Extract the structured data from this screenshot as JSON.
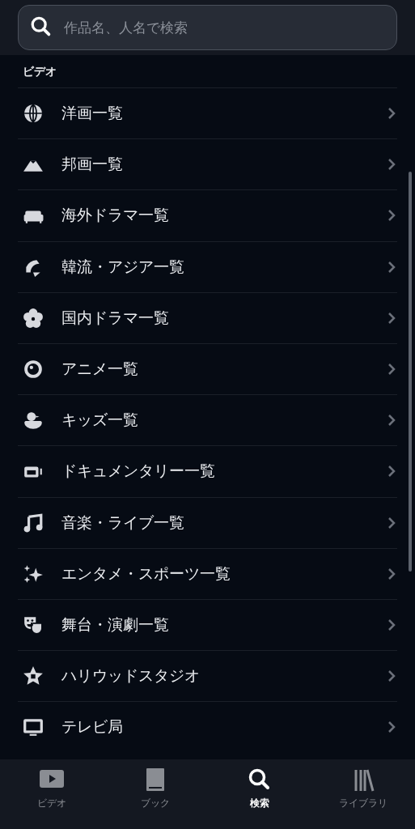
{
  "search": {
    "placeholder": "作品名、人名で検索"
  },
  "section": {
    "title": "ビデオ"
  },
  "items": [
    {
      "label": "洋画一覧"
    },
    {
      "label": "邦画一覧"
    },
    {
      "label": "海外ドラマ一覧"
    },
    {
      "label": "韓流・アジア一覧"
    },
    {
      "label": "国内ドラマ一覧"
    },
    {
      "label": "アニメ一覧"
    },
    {
      "label": "キッズ一覧"
    },
    {
      "label": "ドキュメンタリー一覧"
    },
    {
      "label": "音楽・ライブ一覧"
    },
    {
      "label": "エンタメ・スポーツ一覧"
    },
    {
      "label": "舞台・演劇一覧"
    },
    {
      "label": "ハリウッドスタジオ"
    },
    {
      "label": "テレビ局"
    }
  ],
  "tabs": [
    {
      "label": "ビデオ",
      "selected": false
    },
    {
      "label": "ブック",
      "selected": false
    },
    {
      "label": "検索",
      "selected": true
    },
    {
      "label": "ライブラリ",
      "selected": false
    }
  ]
}
